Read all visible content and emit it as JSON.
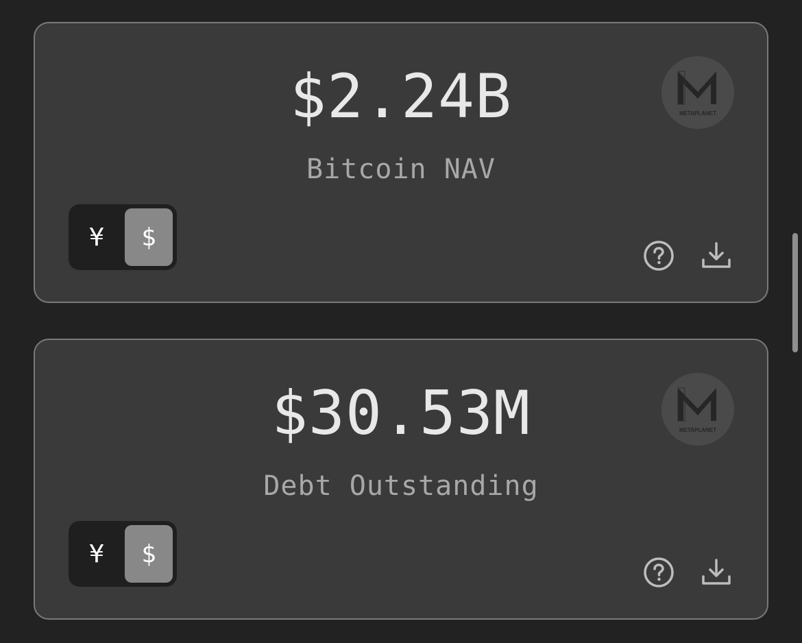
{
  "cards": [
    {
      "value": "$2.24B",
      "label": "Bitcoin NAV",
      "logo_text": "METAPLANET",
      "logo_icon": "metaplanet-logo-icon",
      "currency_toggle": {
        "options": [
          "¥",
          "$"
        ],
        "selected": "$"
      },
      "help_icon": "help-circle-icon",
      "download_icon": "download-icon"
    },
    {
      "value": "$30.53M",
      "label": "Debt Outstanding",
      "logo_text": "METAPLANET",
      "logo_icon": "metaplanet-logo-icon",
      "currency_toggle": {
        "options": [
          "¥",
          "$"
        ],
        "selected": "$"
      },
      "help_icon": "help-circle-icon",
      "download_icon": "download-icon"
    }
  ],
  "colors": {
    "background": "#222222",
    "card": "#3a3a3a",
    "card_border": "#7a7a7a",
    "value_text": "#e8e8e8",
    "label_text": "#a8a8a8",
    "toggle_bg": "#1f1f1f",
    "toggle_active": "#888888",
    "icon": "#bdbdbd"
  }
}
